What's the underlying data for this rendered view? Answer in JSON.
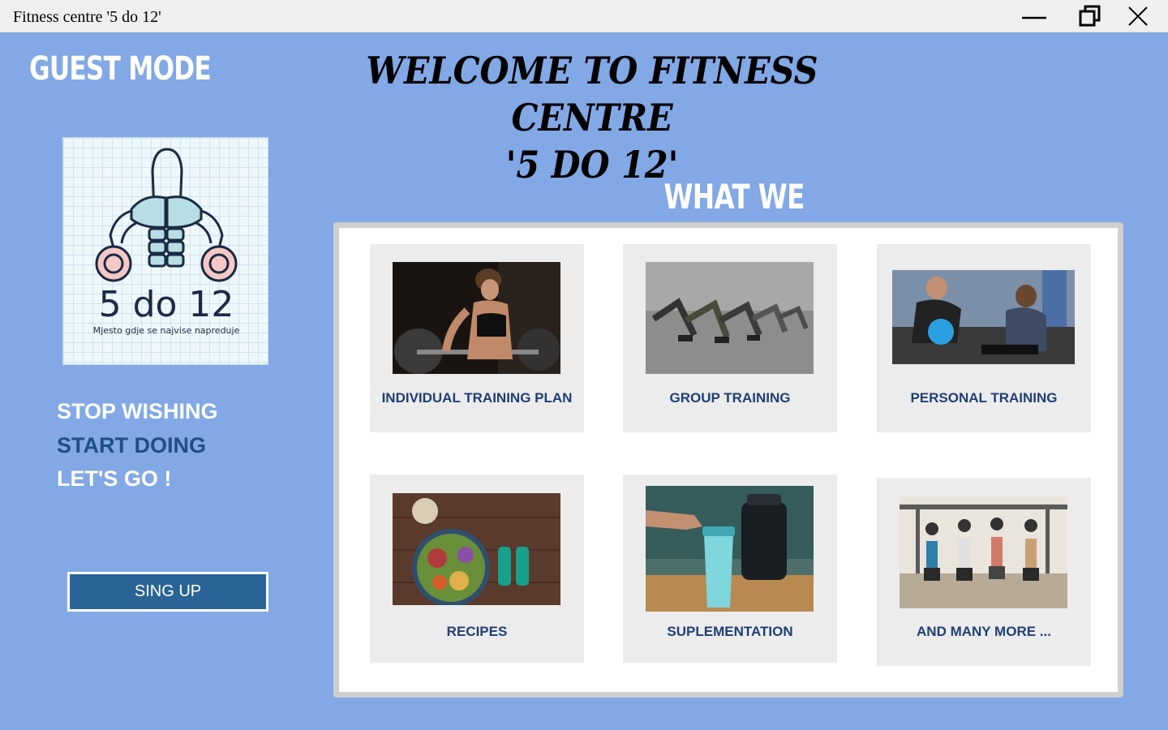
{
  "window": {
    "title": "Fitness centre '5 do 12'"
  },
  "guest_mode": "GUEST MODE",
  "welcome": {
    "line1": "WELCOME TO FITNESS CENTRE",
    "line2": "'5 DO 12'"
  },
  "logo": {
    "brand": "5 do 12",
    "motto": "Mjesto gdje se najvise napreduje"
  },
  "slogan": {
    "line1": "STOP WISHING",
    "line2": "START DOING",
    "line3": "LET'S GO !"
  },
  "signup_label": "SING UP",
  "offer_title": "WHAT WE OFFER :",
  "offers": [
    {
      "label": "INDIVIDUAL TRAINING PLAN",
      "image": "woman-lifting-barbell"
    },
    {
      "label": "GROUP TRAINING",
      "image": "group-plank-dumbbells"
    },
    {
      "label": "PERSONAL TRAINING",
      "image": "trainer-with-client-kettlebell"
    },
    {
      "label": "RECIPES",
      "image": "salad-bowl-dumbbells"
    },
    {
      "label": "SUPLEMENTATION",
      "image": "protein-shaker-supplement"
    },
    {
      "label": "AND MANY MORE ...",
      "image": "group-medicine-ball-squats"
    }
  ],
  "colors": {
    "background": "#82a8e5",
    "signup_button": "#2a6496",
    "card_text": "#1f3f75",
    "slogan_accent": "#1f4e86"
  }
}
